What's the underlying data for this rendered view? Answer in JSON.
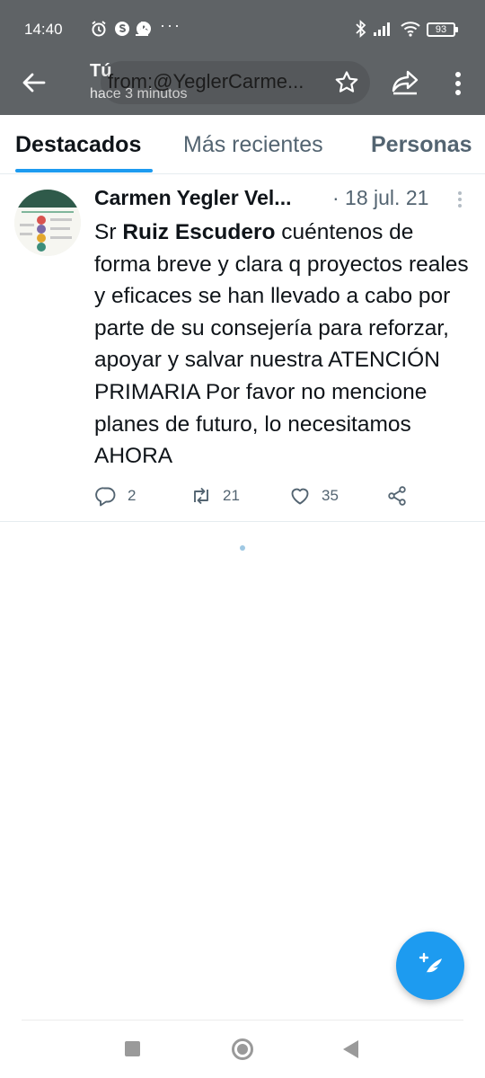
{
  "status_bar": {
    "time": "14:40",
    "battery": "93",
    "more": "···"
  },
  "toolbar": {
    "title": "Tú",
    "subtitle": "hace 3 minutos",
    "search_query": "from:@YeglerCarme..."
  },
  "tabs": [
    {
      "label": "Destacados",
      "active": true
    },
    {
      "label": "Más recientes",
      "active": false
    },
    {
      "label": "Personas",
      "active": false
    }
  ],
  "tweet": {
    "author": "Carmen Yegler Vel...",
    "date": "· 18 jul. 21",
    "text_lead": "Sr ",
    "text_bold": "Ruiz Escudero",
    "text_rest": " cuéntenos de forma breve y clara q proyectos reales y eficaces se han llevado a cabo por parte de su consejería para reforzar, apoyar y salvar nuestra ATENCIÓN PRIMARIA Por favor no mencione planes de futuro, lo necesitamos AHORA",
    "replies": "2",
    "retweets": "21",
    "likes": "35"
  },
  "colors": {
    "accent": "#1d9bf0",
    "toolbar_bg": "#5f6366",
    "secondary_text": "#536471"
  },
  "icons": [
    "back-arrow-icon",
    "star-icon",
    "share-icon",
    "more-vertical-icon",
    "reply-icon",
    "retweet-icon",
    "like-icon",
    "share-nodes-icon",
    "compose-icon"
  ]
}
